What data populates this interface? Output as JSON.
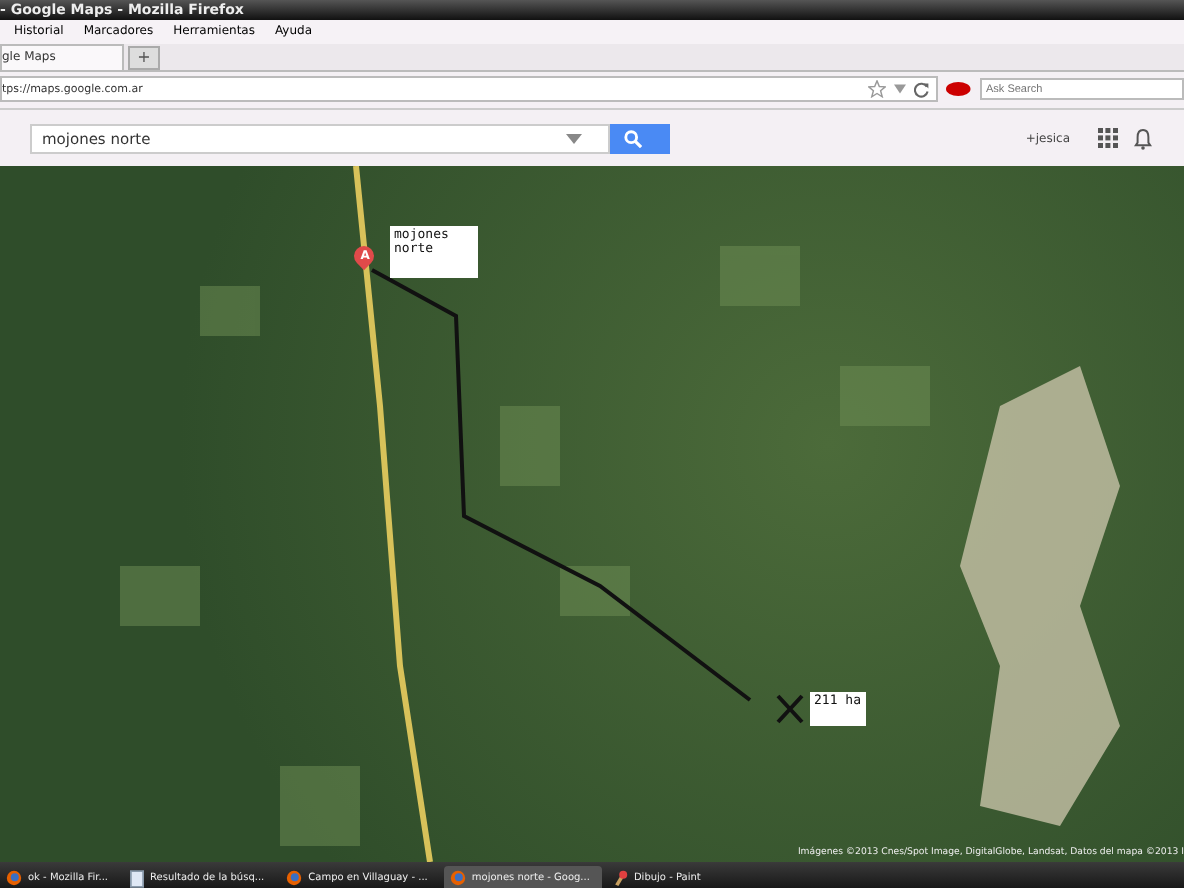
{
  "window": {
    "title": "- Google Maps - Mozilla Firefox"
  },
  "menu": [
    "Historial",
    "Marcadores",
    "Herramientas",
    "Ayuda"
  ],
  "tabs": [
    {
      "label": "gle Maps",
      "selected": true
    }
  ],
  "new_tab": "+",
  "address_bar": {
    "value": "tps://maps.google.com.ar"
  },
  "search_engine": {
    "placeholder": "Ask Search"
  },
  "maps_header": {
    "query": "mojones norte",
    "user": "+jesica"
  },
  "map": {
    "marker_label": "A",
    "notes": [
      {
        "text": "mojones norte"
      },
      {
        "text": "211 ha"
      }
    ],
    "copyright": "Imágenes ©2013 Cnes/Spot Image, DigitalGlobe, Landsat, Datos del mapa ©2013 I"
  },
  "taskbar": [
    {
      "label": "ok - Mozilla Fir...",
      "kind": "browser",
      "selected": false
    },
    {
      "label": "Resultado de la búsq...",
      "kind": "document",
      "selected": false
    },
    {
      "label": "Campo en Villaguay - ...",
      "kind": "browser",
      "selected": false
    },
    {
      "label": "mojones norte - Goog...",
      "kind": "browser",
      "selected": true
    },
    {
      "label": "Dibujo - Paint",
      "kind": "paint",
      "selected": false
    }
  ]
}
